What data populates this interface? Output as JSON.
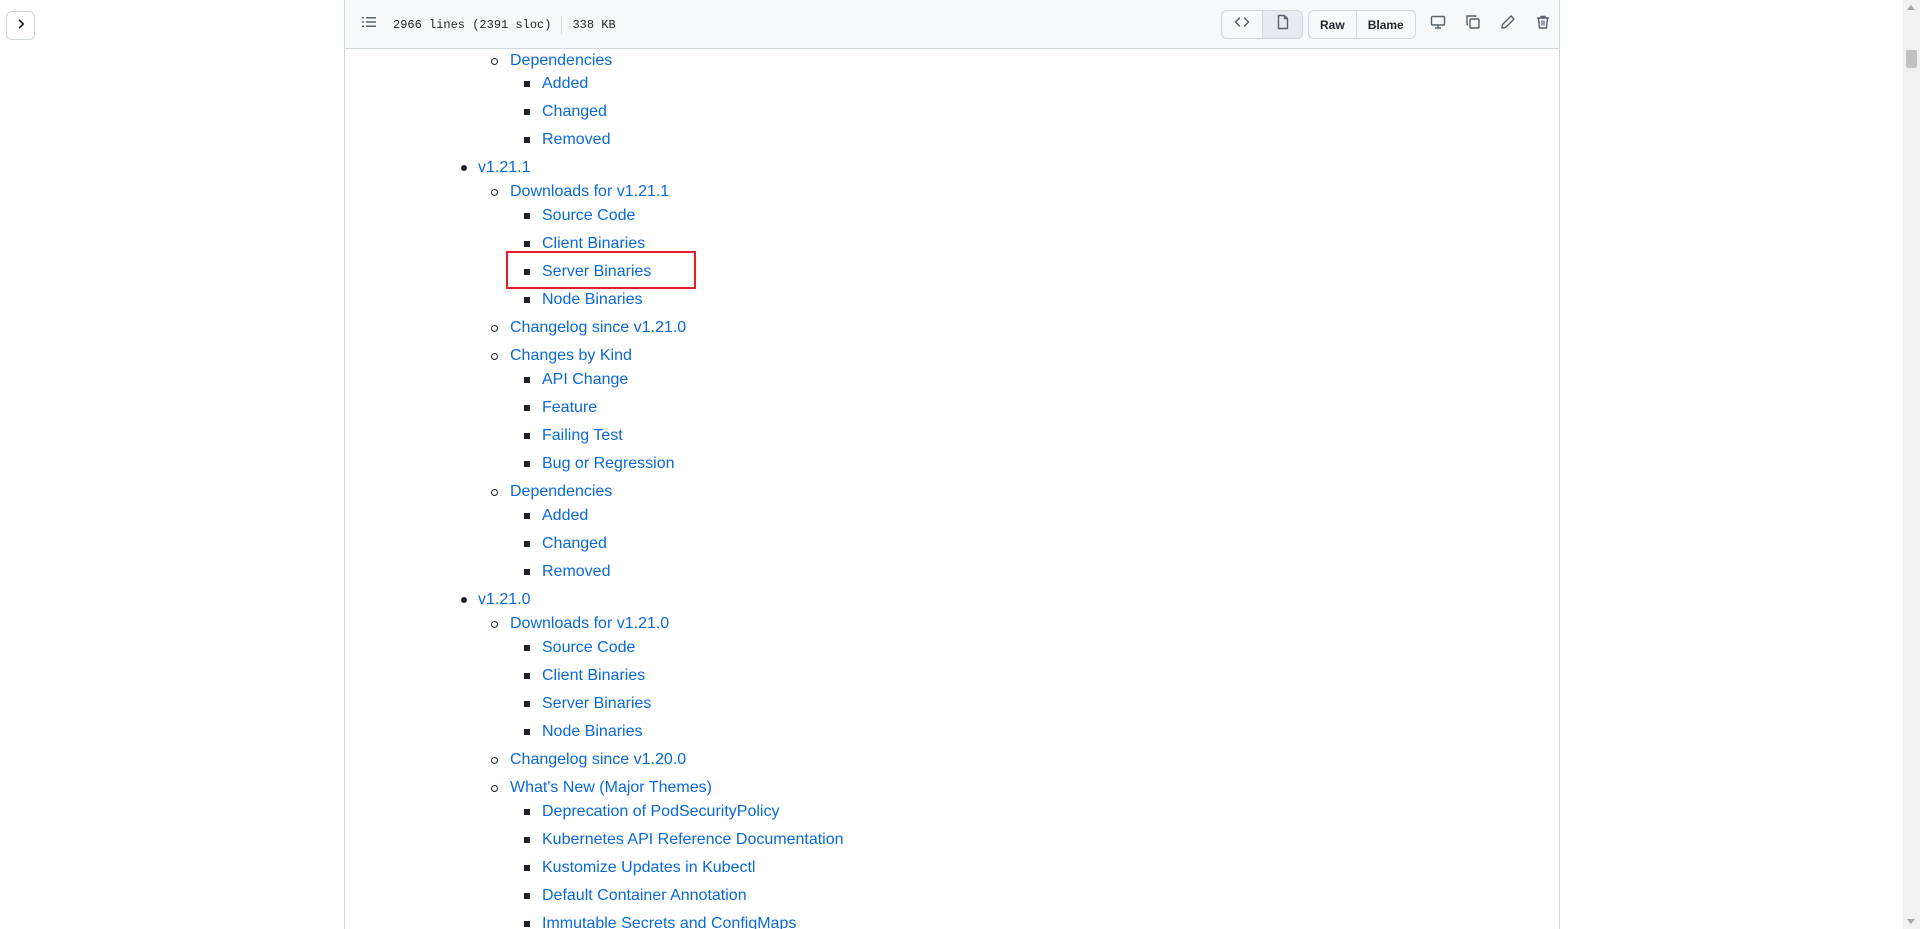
{
  "header": {
    "lines_info": "2966 lines (2391 sloc)",
    "size_info": "338 KB",
    "raw_label": "Raw",
    "blame_label": "Blame"
  },
  "toc": {
    "deps_1": {
      "label": "Dependencies",
      "items": [
        "Added",
        "Changed",
        "Removed"
      ]
    },
    "v1_21_1": {
      "label": "v1.21.1",
      "downloads": {
        "label": "Downloads for v1.21.1",
        "items": [
          "Source Code",
          "Client Binaries",
          "Server Binaries",
          "Node Binaries"
        ]
      },
      "changelog": "Changelog since v1.21.0",
      "changes_by_kind": {
        "label": "Changes by Kind",
        "items": [
          "API Change",
          "Feature",
          "Failing Test",
          "Bug or Regression"
        ]
      },
      "dependencies": {
        "label": "Dependencies",
        "items": [
          "Added",
          "Changed",
          "Removed"
        ]
      }
    },
    "v1_21_0": {
      "label": "v1.21.0",
      "downloads": {
        "label": "Downloads for v1.21.0",
        "items": [
          "Source Code",
          "Client Binaries",
          "Server Binaries",
          "Node Binaries"
        ]
      },
      "changelog": "Changelog since v1.20.0",
      "whats_new": {
        "label": "What's New (Major Themes)",
        "items": [
          "Deprecation of PodSecurityPolicy",
          "Kubernetes API Reference Documentation",
          "Kustomize Updates in Kubectl",
          "Default Container Annotation",
          "Immutable Secrets and ConfigMaps"
        ]
      }
    }
  },
  "colors": {
    "link": "#0969da",
    "highlight": "#e0202a"
  }
}
